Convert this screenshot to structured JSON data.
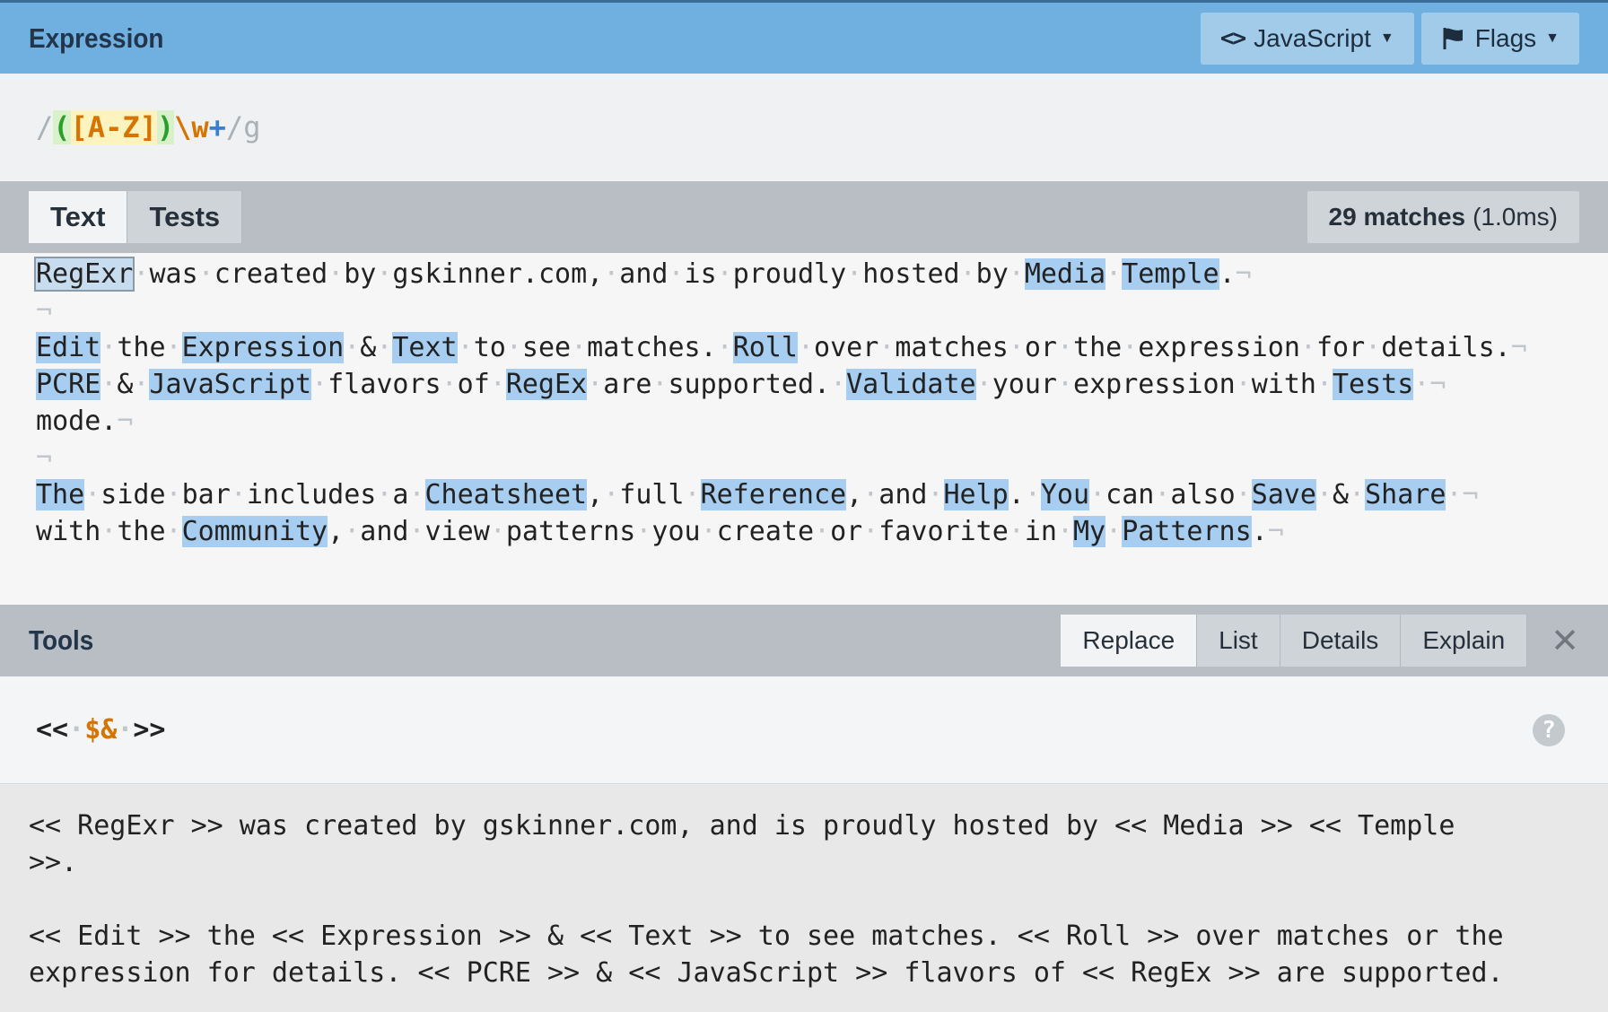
{
  "header": {
    "title": "Expression",
    "lang_button": "JavaScript",
    "flags_button": "Flags"
  },
  "expression": {
    "open_slash": "/",
    "open_paren": "(",
    "char_set": "[A-Z]",
    "close_paren": ")",
    "escape": "\\w",
    "quantifier": "+",
    "close_slash": "/",
    "flags": "g"
  },
  "tabs": [
    {
      "label": "Text"
    },
    {
      "label": "Tests"
    }
  ],
  "match_info": {
    "count": "29 matches",
    "time": "(1.0ms)"
  },
  "text_lines": [
    [
      {
        "t": "RegExr",
        "m": true
      },
      {
        "t": " was created by gskinner.com, and is proudly hosted by "
      },
      {
        "t": "Media",
        "m": true
      },
      {
        "t": " "
      },
      {
        "t": "Temple",
        "m": true
      },
      {
        "t": "."
      }
    ],
    [],
    [
      {
        "t": "Edit",
        "m": true
      },
      {
        "t": " the "
      },
      {
        "t": "Expression",
        "m": true
      },
      {
        "t": " & "
      },
      {
        "t": "Text",
        "m": true
      },
      {
        "t": " to see matches. "
      },
      {
        "t": "Roll",
        "m": true
      },
      {
        "t": " over matches or the expression for details."
      }
    ],
    [
      {
        "t": "PCRE",
        "m": true
      },
      {
        "t": " & "
      },
      {
        "t": "JavaScript",
        "m": true
      },
      {
        "t": " flavors of "
      },
      {
        "t": "RegEx",
        "m": true
      },
      {
        "t": " are supported. "
      },
      {
        "t": "Validate",
        "m": true
      },
      {
        "t": " your expression with "
      },
      {
        "t": "Tests",
        "m": true
      },
      {
        "t": " "
      }
    ],
    [
      {
        "t": "mode."
      }
    ],
    [],
    [
      {
        "t": "The",
        "m": true
      },
      {
        "t": " side bar includes a "
      },
      {
        "t": "Cheatsheet",
        "m": true
      },
      {
        "t": ", full "
      },
      {
        "t": "Reference",
        "m": true
      },
      {
        "t": ", and "
      },
      {
        "t": "Help",
        "m": true
      },
      {
        "t": ". "
      },
      {
        "t": "You",
        "m": true
      },
      {
        "t": " can also "
      },
      {
        "t": "Save",
        "m": true
      },
      {
        "t": " & "
      },
      {
        "t": "Share",
        "m": true
      },
      {
        "t": " "
      }
    ],
    [
      {
        "t": "with the "
      },
      {
        "t": "Community",
        "m": true
      },
      {
        "t": ", and view patterns you create or favorite in "
      },
      {
        "t": "My",
        "m": true
      },
      {
        "t": " "
      },
      {
        "t": "Patterns",
        "m": true
      },
      {
        "t": "."
      }
    ]
  ],
  "tools": {
    "title": "Tools",
    "tabs": [
      "Replace",
      "List",
      "Details",
      "Explain"
    ],
    "active": "Replace"
  },
  "replace": {
    "prefix": "<<",
    "token": "$&",
    "suffix": ">>"
  },
  "result_lines": [
    "<< RegExr >> was created by gskinner.com, and is proudly hosted by << Media >> << Temple",
    ">>.",
    "",
    "<< Edit >> the << Expression >> & << Text >> to see matches. << Roll >> over matches or the",
    "expression for details. << PCRE >> & << JavaScript >> flavors of << RegEx >> are supported."
  ]
}
